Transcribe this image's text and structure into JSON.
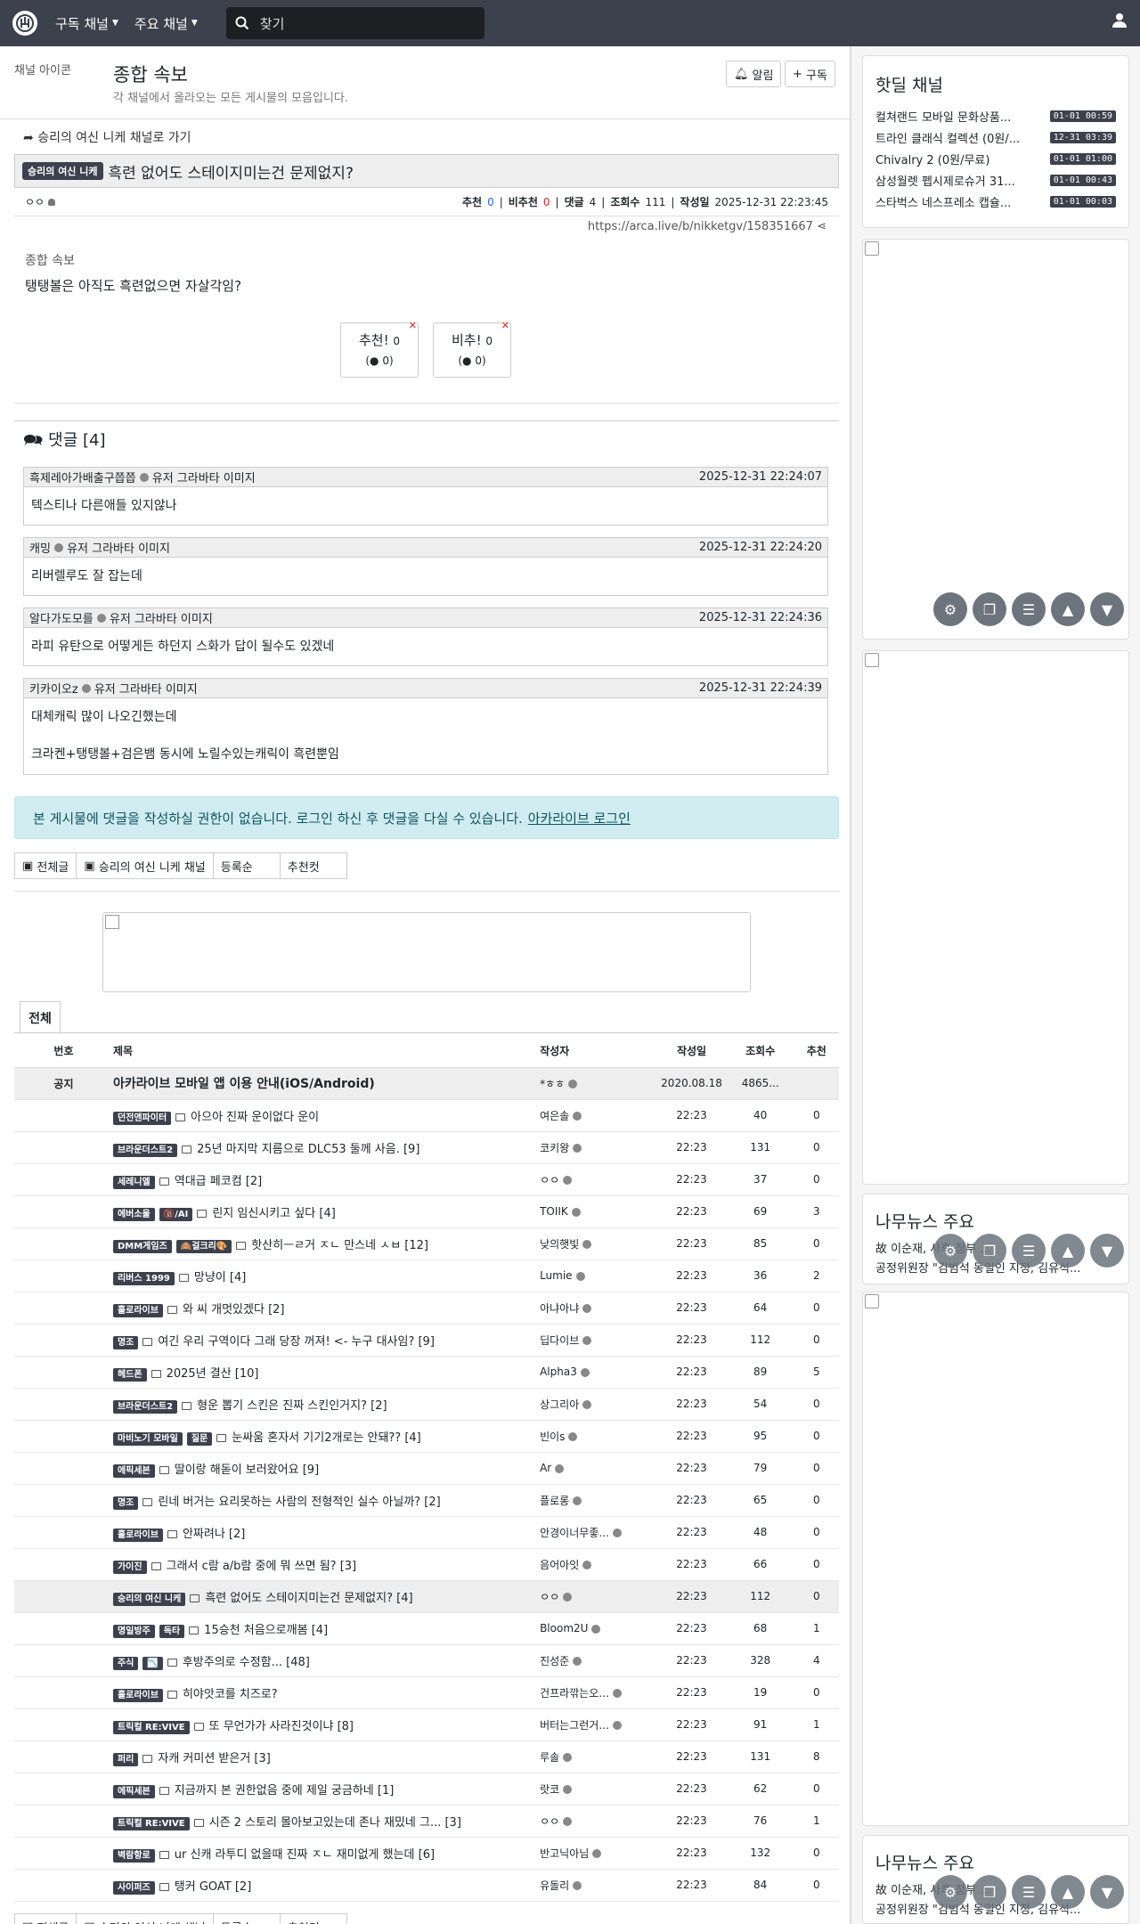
{
  "topnav": {
    "menu1": "구독 채널",
    "menu2": "주요 채널",
    "search_placeholder": "찾기"
  },
  "board": {
    "image_alt": "채널 아이콘",
    "title": "종합 속보",
    "description": "각 채널에서 올라오는 모든 게시물의 모음입니다.",
    "alarm": "알림",
    "subscribe": "구독"
  },
  "article": {
    "goto_channel": "승리의 여신 니케 채널로 가기",
    "channel_badge": "승리의 여신 니케",
    "title": "흑련 없어도 스테이지미는건 문제없지?",
    "author": "ㅇㅇ",
    "rec_label": "추천",
    "rec": "0",
    "unrec_label": "비추천",
    "unrec": "0",
    "comment_label": "댓글",
    "comments": "4",
    "views_label": "조회수",
    "views": "111",
    "date_label": "작성일",
    "date": "2025-12-31 22:23:45",
    "url": "https://arca.live/b/nikketgv/158351667",
    "image_alt": "종합 속보",
    "body": "탱탱볼은 아직도 흑련없으면 자살각임?",
    "vote_up": "추천!",
    "vote_up_count": "0",
    "vote_up_sub": "0",
    "vote_down": "비추!",
    "vote_down_count": "0",
    "vote_down_sub": "0"
  },
  "comments": {
    "title": "댓글 [4]",
    "avatar_alt": "유저 그라바타 이미지",
    "items": [
      {
        "author": "흑제레아가배출구쯥쯥",
        "date": "2025-12-31 22:24:07",
        "text": "텍스티나 다른애들 있지않나",
        "text2": ""
      },
      {
        "author": "캐밍",
        "date": "2025-12-31 22:24:20",
        "text": "리버렐루도 잘 잡는데",
        "text2": ""
      },
      {
        "author": "알다가도모를",
        "date": "2025-12-31 22:24:36",
        "text": "라피 유탄으로 어떻게든 하던지 스화가 답이 될수도 있겠네",
        "text2": ""
      },
      {
        "author": "키카이오z",
        "date": "2025-12-31 22:24:39",
        "text": "대체캐릭 많이 나오긴했는데",
        "text2": "크라켄+탱탱볼+검은뱀 동시에 노릴수있는캐릭이 흑련뿐임"
      }
    ]
  },
  "notice": {
    "text": "본 게시물에 댓글을 작성하실 권한이 없습니다. 로그인 하신 후 댓글을 다실 수 있습니다.",
    "link": "아카라이브 로그인"
  },
  "filters": {
    "all": "전체글",
    "channel": "승리의 여신 니케 채널",
    "order": "등록순",
    "best": "추천컷"
  },
  "list": {
    "tab": "전체",
    "headers": {
      "no": "번호",
      "title": "제목",
      "author": "작성자",
      "date": "작성일",
      "views": "조회수",
      "rec": "추천"
    },
    "notice_row": {
      "no": "공지",
      "title": "아카라이브 모바일 앱 이용 안내(iOS/Android)",
      "author": "*ㅎㅎ",
      "date": "2020.08.18",
      "views": "4865...",
      "rec": ""
    },
    "rows": [
      {
        "badge": "던전앤파이터",
        "badge2": "",
        "title": "아으아 진짜 운이없다 운이",
        "author": "여은솔",
        "date": "22:23",
        "views": "40",
        "rec": "0"
      },
      {
        "badge": "브라운더스트2",
        "badge2": "",
        "title": "25년 마지막 지름으로 DLC53 둘께 사음. [9]",
        "author": "코키왕",
        "date": "22:23",
        "views": "131",
        "rec": "0"
      },
      {
        "badge": "세레니엘",
        "badge2": "",
        "title": "역대급 페코컴 [2]",
        "author": "ㅇㅇ",
        "date": "22:23",
        "views": "37",
        "rec": "0"
      },
      {
        "badge": "에버소울",
        "badge2": "🔞/AI",
        "title": "린지 임신시키고 싶다 [4]",
        "author": "TOIIK",
        "date": "22:23",
        "views": "69",
        "rec": "3"
      },
      {
        "badge": "DMM게임즈",
        "badge2": "🙈걸크리🎨",
        "title": "핫산히ㅡㄹ거 ㅈㄴ 만스네 ㅅㅂ [12]",
        "author": "낮의햇빛",
        "date": "22:23",
        "views": "85",
        "rec": "0"
      },
      {
        "badge": "리버스 1999",
        "badge2": "",
        "title": "망냥이 [4]",
        "author": "Lumie",
        "date": "22:23",
        "views": "36",
        "rec": "2"
      },
      {
        "badge": "홀로라이브",
        "badge2": "",
        "title": "와 씨 개멋있겠다 [2]",
        "author": "아냐아냐",
        "date": "22:23",
        "views": "64",
        "rec": "0"
      },
      {
        "badge": "명조",
        "badge2": "",
        "title": "여긴 우리 구역이다 그래 당장 꺼져! <- 누구 대사임? [9]",
        "author": "딥다이브",
        "date": "22:23",
        "views": "112",
        "rec": "0"
      },
      {
        "badge": "헤드폰",
        "badge2": "",
        "title": "2025년 결산 [10]",
        "author": "Alpha3",
        "date": "22:23",
        "views": "89",
        "rec": "5"
      },
      {
        "badge": "브라운더스트2",
        "badge2": "",
        "title": "형운 뽑기 스킨은 진짜 스킨인거지? [2]",
        "author": "상그리아",
        "date": "22:23",
        "views": "54",
        "rec": "0"
      },
      {
        "badge": "마비노기 모바일",
        "badge2": "질문",
        "title": "눈싸움 혼자서 기기2개로는 안돼?? [4]",
        "author": "빈이s",
        "date": "22:23",
        "views": "95",
        "rec": "0"
      },
      {
        "badge": "에픽세븐",
        "badge2": "",
        "title": "딸이랑 해돋이 보러왔어요 [9]",
        "author": "Ar",
        "date": "22:23",
        "views": "79",
        "rec": "0"
      },
      {
        "badge": "명조",
        "badge2": "",
        "title": "린네 버거는 요리못하는 사람의 전형적인 실수 아닐까? [2]",
        "author": "플로롱",
        "date": "22:23",
        "views": "65",
        "rec": "0"
      },
      {
        "badge": "홀로라이브",
        "badge2": "",
        "title": "안짜려나 [2]",
        "author": "안경이너무좋...",
        "date": "22:23",
        "views": "48",
        "rec": "0"
      },
      {
        "badge": "가이진",
        "badge2": "",
        "title": "그래서 c람 a/b람 중에 뭐 쓰면 됨? [3]",
        "author": "음어아잇",
        "date": "22:23",
        "views": "66",
        "rec": "0"
      },
      {
        "badge": "승리의 여신 니케",
        "badge2": "",
        "title": "흑련 없어도 스테이지미는건 문제없지? [4]",
        "author": "ㅇㅇ",
        "date": "22:23",
        "views": "112",
        "rec": "0"
      },
      {
        "badge": "명일방주",
        "badge2": "독타",
        "title": "15승천 처음으로깨봄 [4]",
        "author": "Bloom2U",
        "date": "22:23",
        "views": "68",
        "rec": "1"
      },
      {
        "badge": "주식",
        "badge2": "📉",
        "title": "후방주의로 수정함... [48]",
        "author": "진성준",
        "date": "22:23",
        "views": "328",
        "rec": "4"
      },
      {
        "badge": "홀로라이브",
        "badge2": "",
        "title": "히야앗코를 치즈로?",
        "author": "건프라깎는오...",
        "date": "22:23",
        "views": "19",
        "rec": "0"
      },
      {
        "badge": "트릭컬 RE:VIVE",
        "badge2": "",
        "title": "또 무언가가 사라진것이냐 [8]",
        "author": "버터는그런거...",
        "date": "22:23",
        "views": "91",
        "rec": "1"
      },
      {
        "badge": "퍼리",
        "badge2": "",
        "title": "자캐 커미션 받은거 [3]",
        "author": "루솔",
        "date": "22:23",
        "views": "131",
        "rec": "8"
      },
      {
        "badge": "에픽세븐",
        "badge2": "",
        "title": "지금까지 본 권한없음 중에 제일 궁금하네 [1]",
        "author": "랏코",
        "date": "22:23",
        "views": "62",
        "rec": "0"
      },
      {
        "badge": "트릭컬 RE:VIVE",
        "badge2": "",
        "title": "시즌 2 스토리 몰아보고있는데 존나 재밌네 그... [3]",
        "author": "ㅇㅇ",
        "date": "22:23",
        "views": "76",
        "rec": "1"
      },
      {
        "badge": "벽람항로",
        "badge2": "",
        "title": "ur 신캐 라투디 없을때 진짜 ㅈㄴ 재미없게 했는데 [6]",
        "author": "반고닉아님",
        "date": "22:23",
        "views": "132",
        "rec": "0"
      },
      {
        "badge": "사이퍼즈",
        "badge2": "",
        "title": "탱커 GOAT [2]",
        "author": "유돌리",
        "date": "22:23",
        "views": "84",
        "rec": "0"
      }
    ]
  },
  "sidebar": {
    "hotdeal_title": "핫딜 채널",
    "hotdeals": [
      {
        "title": "컬쳐랜드 모바일 문화상품...",
        "time": "01-01 00:59"
      },
      {
        "title": "트라인 클래식 컬렉션 (0원/...",
        "time": "12-31 03:39"
      },
      {
        "title": "Chivalry 2 (0원/무료)",
        "time": "01-01 01:00"
      },
      {
        "title": "삼성월렛 펩시제로슈거 31...",
        "time": "01-01 00:43"
      },
      {
        "title": "스타벅스 네스프레소 캡슐...",
        "time": "01-01 00:03"
      }
    ],
    "news_title": "나무뉴스 주요",
    "news_line1": "故 이순재, 사후 정부 ...",
    "news_line2": "공정위원장 \"김범석 동일인 지정, 김유석..."
  }
}
